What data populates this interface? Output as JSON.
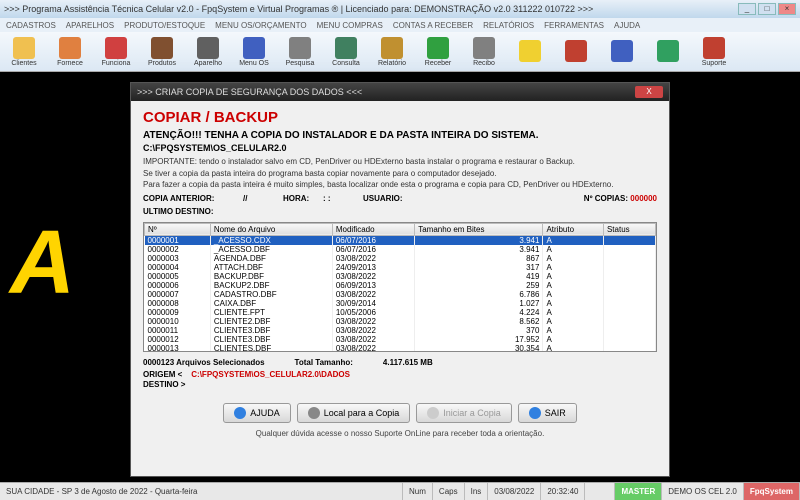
{
  "window": {
    "title": ">>> Programa Assistência Técnica Celular v2.0 - FpqSystem e Virtual Programas ® | Licenciado para: DEMONSTRAÇÃO v2.0 311222 010722 >>>"
  },
  "menu": [
    "CADASTROS",
    "APARELHOS",
    "PRODUTO/ESTOQUE",
    "MENU OS/ORÇAMENTO",
    "MENU COMPRAS",
    "CONTAS A RECEBER",
    "RELATÓRIOS",
    "FERRAMENTAS",
    "AJUDA"
  ],
  "toolbar": [
    {
      "label": "Clientes",
      "color": "#f0c050"
    },
    {
      "label": "Fornece",
      "color": "#e08040"
    },
    {
      "label": "Funciona",
      "color": "#d04040"
    },
    {
      "label": "Produtos",
      "color": "#805030"
    },
    {
      "label": "Aparelho",
      "color": "#606060"
    },
    {
      "label": "Menu OS",
      "color": "#4060c0"
    },
    {
      "label": "Pesquisa",
      "color": "#808080"
    },
    {
      "label": "Consulta",
      "color": "#408060"
    },
    {
      "label": "Relatório",
      "color": "#c09030"
    },
    {
      "label": "Receber",
      "color": "#30a040"
    },
    {
      "label": "Recibo",
      "color": "#808080"
    },
    {
      "label": "",
      "color": "#f0d030"
    },
    {
      "label": "",
      "color": "#c04030"
    },
    {
      "label": "",
      "color": "#4060c0"
    },
    {
      "label": "",
      "color": "#30a060"
    },
    {
      "label": "Suporte",
      "color": "#c04030"
    }
  ],
  "dialog": {
    "title": ">>> CRIAR COPIA DE SEGURANÇA DOS DADOS <<<",
    "heading": "COPIAR / BACKUP",
    "warn": "ATENÇÃO!!!  TENHA A COPIA DO INSTALADOR E DA PASTA INTEIRA DO SISTEMA.",
    "cpath": "C:\\FPQSYSTEM\\OS_CELULAR2.0",
    "note1": "IMPORTANTE: tendo o instalador salvo em CD, PenDriver ou HDExterno basta instalar o programa e restaurar o Backup.",
    "note2": "Se tiver a copia da pasta inteira do programa basta copiar novamente para o computador desejado.",
    "note3": "Para fazer a copia da pasta inteira é muito simples, basta localizar onde esta o programa e copia para CD, PenDriver ou HDExterno.",
    "copia_anterior_label": "COPIA ANTERIOR:",
    "copia_anterior_val": "//",
    "hora_label": "HORA:",
    "hora_val": ": :",
    "usuario_label": "USUARIO:",
    "ncopias_label": "Nº COPIAS:",
    "ncopias_val": "000000",
    "ultimo_label": "ULTIMO DESTINO:",
    "cols": [
      "Nº",
      "Nome do Arquivo",
      "Modificado",
      "Tamanho em Bites",
      "Atributo",
      "Status"
    ],
    "rows": [
      {
        "n": "0000001",
        "nome": "_ACESSO.CDX",
        "mod": "06/07/2016",
        "tam": "3.941",
        "attr": "A",
        "st": ""
      },
      {
        "n": "0000002",
        "nome": "_ACESSO.DBF",
        "mod": "06/07/2016",
        "tam": "3.941",
        "attr": "A",
        "st": ""
      },
      {
        "n": "0000003",
        "nome": "AGENDA.DBF",
        "mod": "03/08/2022",
        "tam": "867",
        "attr": "A",
        "st": ""
      },
      {
        "n": "0000004",
        "nome": "ATTACH.DBF",
        "mod": "24/09/2013",
        "tam": "317",
        "attr": "A",
        "st": ""
      },
      {
        "n": "0000005",
        "nome": "BACKUP.DBF",
        "mod": "03/08/2022",
        "tam": "419",
        "attr": "A",
        "st": ""
      },
      {
        "n": "0000006",
        "nome": "BACKUP2.DBF",
        "mod": "06/09/2013",
        "tam": "259",
        "attr": "A",
        "st": ""
      },
      {
        "n": "0000007",
        "nome": "CADASTRO.DBF",
        "mod": "03/08/2022",
        "tam": "6.786",
        "attr": "A",
        "st": ""
      },
      {
        "n": "0000008",
        "nome": "CAIXA.DBF",
        "mod": "30/09/2014",
        "tam": "1.027",
        "attr": "A",
        "st": ""
      },
      {
        "n": "0000009",
        "nome": "CLIENTE.FPT",
        "mod": "10/05/2006",
        "tam": "4.224",
        "attr": "A",
        "st": ""
      },
      {
        "n": "0000010",
        "nome": "CLIENTE2.DBF",
        "mod": "03/08/2022",
        "tam": "8.562",
        "attr": "A",
        "st": ""
      },
      {
        "n": "0000011",
        "nome": "CLIENTE3.DBF",
        "mod": "03/08/2022",
        "tam": "370",
        "attr": "A",
        "st": ""
      },
      {
        "n": "0000012",
        "nome": "CLIENTE3.DBF",
        "mod": "03/08/2022",
        "tam": "17.952",
        "attr": "A",
        "st": ""
      },
      {
        "n": "0000013",
        "nome": "CLIENTES.DBF",
        "mod": "03/08/2022",
        "tam": "30.354",
        "attr": "A",
        "st": ""
      }
    ],
    "summary_count": "0000123 Arquivos Selecionados",
    "summary_total_label": "Total Tamanho:",
    "summary_total_val": "4.117.615 MB",
    "origem_label": "ORIGEM  <",
    "origem_val": "C:\\FPQSYSTEM\\OS_CELULAR2.0\\DADOS",
    "destino_label": "DESTINO >",
    "buttons": {
      "ajuda": "AJUDA",
      "local": "Local para a Copia",
      "iniciar": "Iniciar a Copia",
      "sair": "SAIR"
    },
    "footer": "Qualquer dúvida acesse o nosso Suporte OnLine para receber toda a orientação."
  },
  "status": {
    "left": "SUA CIDADE - SP  3 de Agosto de 2022 - Quarta-feira",
    "num": "Num",
    "caps": "Caps",
    "ins": "Ins",
    "date": "03/08/2022",
    "time": "20:32:40",
    "master": "MASTER",
    "demo": "DEMO OS CEL 2.0",
    "brand": "FpqSystem"
  }
}
